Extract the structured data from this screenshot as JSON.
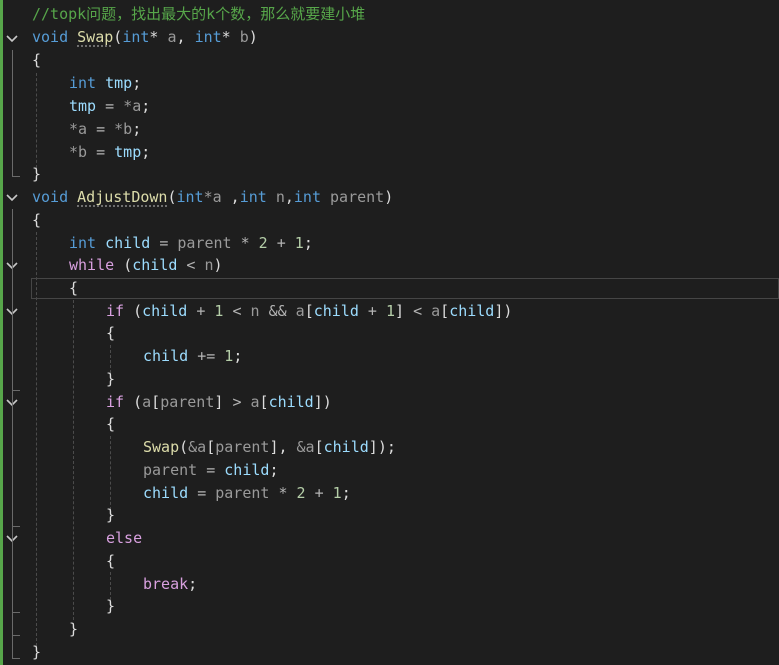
{
  "code": {
    "comment": "//topk问题，找出最大的k个数，那么就要建小堆",
    "kw_void": "void",
    "kw_int": "int",
    "kw_while": "while",
    "kw_if": "if",
    "kw_else": "else",
    "kw_break": "break",
    "fn_swap": "Swap",
    "fn_adjustdown": "AdjustDown",
    "p_a": "a",
    "p_b": "b",
    "p_n": "n",
    "p_parent": "parent",
    "v_tmp": "tmp",
    "v_child": "child",
    "n_1": "1",
    "n_2": "2",
    "sym_star_a": "*a",
    "sym_star_b": "*b",
    "sym_amp_a": "&a",
    "op_eq": "=",
    "op_mul": "*",
    "op_plus": "+",
    "op_lt": "<",
    "op_gt": ">",
    "op_and": "&&",
    "op_pluseq": "+=",
    "brace_open": "{",
    "brace_close": "}",
    "paren_open": "(",
    "paren_close": ")",
    "bracket_open": "[",
    "bracket_close": "]",
    "semicolon": ";",
    "comma": ",",
    "star": "*",
    "ptr_param": "int* ",
    "space_comma": " ,"
  },
  "colors": {
    "background": "#1e1e1e",
    "keyword": "#569cd6",
    "control": "#d8a0df",
    "function": "#dcdcaa",
    "parameter": "#9a9a9a",
    "local_variable": "#9cdcfe",
    "comment": "#57a64a",
    "number": "#b5cea8"
  },
  "icons": {
    "fold": "chevron-down-icon"
  }
}
